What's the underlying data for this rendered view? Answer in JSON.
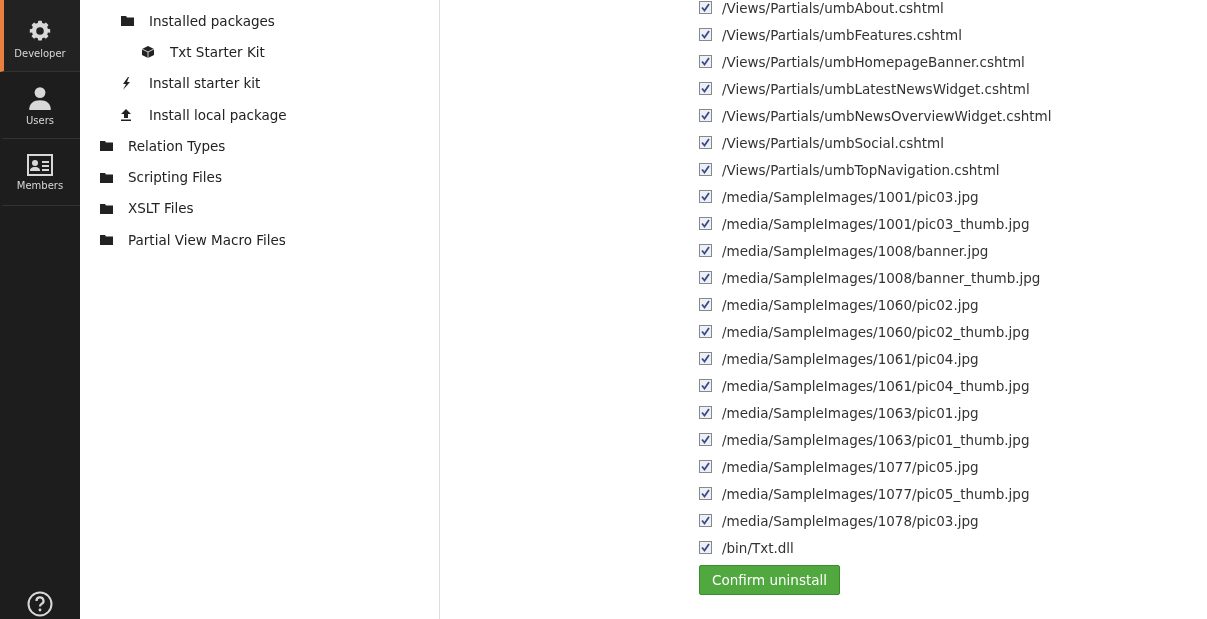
{
  "sidebar": {
    "sections": [
      {
        "label": "Developer",
        "selected": true
      },
      {
        "label": "Users",
        "selected": false
      },
      {
        "label": "Members",
        "selected": false
      }
    ]
  },
  "tree": {
    "continued_children": [
      {
        "label": "Installed packages",
        "kind": "folder",
        "children": [
          {
            "label": "Txt Starter Kit",
            "kind": "package"
          }
        ]
      },
      {
        "label": "Install starter kit",
        "kind": "starter"
      },
      {
        "label": "Install local package",
        "kind": "upload"
      }
    ],
    "items": [
      {
        "label": "Relation Types",
        "kind": "folder"
      },
      {
        "label": "Scripting Files",
        "kind": "folder"
      },
      {
        "label": "XSLT Files",
        "kind": "folder"
      },
      {
        "label": "Partial View Macro Files",
        "kind": "folder"
      }
    ]
  },
  "files": [
    {
      "path": "/Views/Partials/umbAbout.cshtml",
      "checked": true
    },
    {
      "path": "/Views/Partials/umbFeatures.cshtml",
      "checked": true
    },
    {
      "path": "/Views/Partials/umbHomepageBanner.cshtml",
      "checked": true
    },
    {
      "path": "/Views/Partials/umbLatestNewsWidget.cshtml",
      "checked": true
    },
    {
      "path": "/Views/Partials/umbNewsOverviewWidget.cshtml",
      "checked": true
    },
    {
      "path": "/Views/Partials/umbSocial.cshtml",
      "checked": true
    },
    {
      "path": "/Views/Partials/umbTopNavigation.cshtml",
      "checked": true
    },
    {
      "path": "/media/SampleImages/1001/pic03.jpg",
      "checked": true
    },
    {
      "path": "/media/SampleImages/1001/pic03_thumb.jpg",
      "checked": true
    },
    {
      "path": "/media/SampleImages/1008/banner.jpg",
      "checked": true
    },
    {
      "path": "/media/SampleImages/1008/banner_thumb.jpg",
      "checked": true
    },
    {
      "path": "/media/SampleImages/1060/pic02.jpg",
      "checked": true
    },
    {
      "path": "/media/SampleImages/1060/pic02_thumb.jpg",
      "checked": true
    },
    {
      "path": "/media/SampleImages/1061/pic04.jpg",
      "checked": true
    },
    {
      "path": "/media/SampleImages/1061/pic04_thumb.jpg",
      "checked": true
    },
    {
      "path": "/media/SampleImages/1063/pic01.jpg",
      "checked": true
    },
    {
      "path": "/media/SampleImages/1063/pic01_thumb.jpg",
      "checked": true
    },
    {
      "path": "/media/SampleImages/1077/pic05.jpg",
      "checked": true
    },
    {
      "path": "/media/SampleImages/1077/pic05_thumb.jpg",
      "checked": true
    },
    {
      "path": "/media/SampleImages/1078/pic03.jpg",
      "checked": true
    },
    {
      "path": "/bin/Txt.dll",
      "checked": true
    }
  ],
  "confirm_button": "Confirm uninstall"
}
